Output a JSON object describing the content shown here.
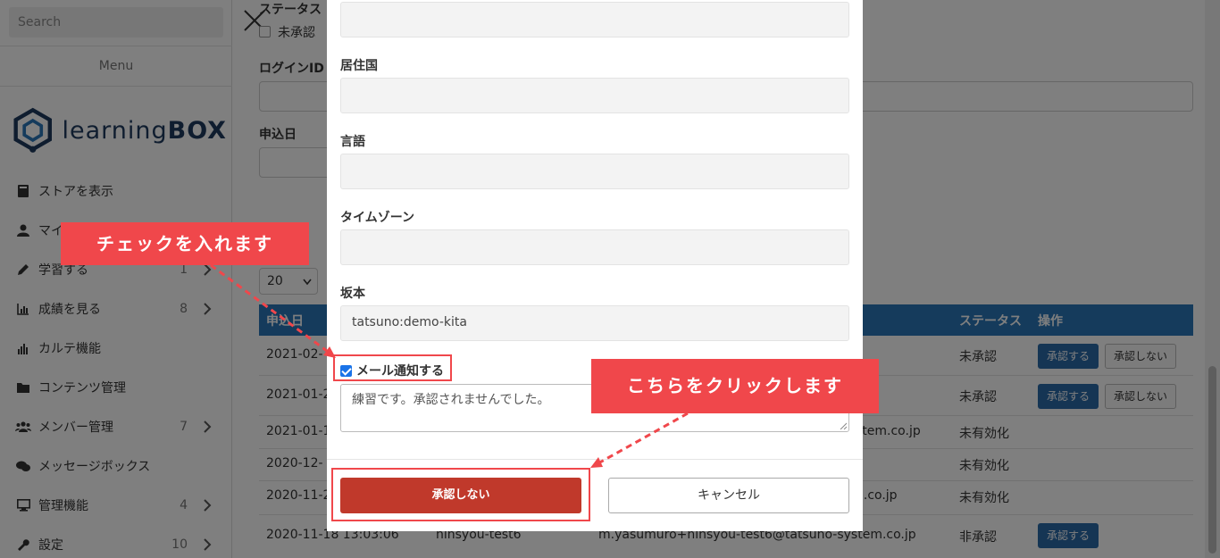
{
  "sidebar": {
    "search_placeholder": "Search",
    "menu_label": "Menu",
    "logo": {
      "light": "learning",
      "bold": "BOX"
    },
    "items": [
      {
        "label": "ストアを表示",
        "count": "",
        "icon": "book-icon"
      },
      {
        "label": "マイページ",
        "count": "",
        "icon": "user-icon"
      },
      {
        "label": "学習する",
        "count": "1",
        "icon": "pencil-icon"
      },
      {
        "label": "成績を見る",
        "count": "8",
        "icon": "chart-icon"
      },
      {
        "label": "カルテ機能",
        "count": "",
        "icon": "bar-chart-icon"
      },
      {
        "label": "コンテンツ管理",
        "count": "",
        "icon": "folder-icon"
      },
      {
        "label": "メンバー管理",
        "count": "7",
        "icon": "users-icon"
      },
      {
        "label": "メッセージボックス",
        "count": "",
        "icon": "comments-icon"
      },
      {
        "label": "管理機能",
        "count": "4",
        "icon": "monitor-icon"
      },
      {
        "label": "設定",
        "count": "10",
        "icon": "wrench-icon"
      }
    ]
  },
  "main": {
    "status_label": "ステータス",
    "unapproved_label": "未承認",
    "login_id_label": "ログインID",
    "apply_date_label": "申込日",
    "per_page": "20",
    "table": {
      "headers": {
        "date": "申込日",
        "status": "ステータス",
        "ops": "操作"
      },
      "rows": [
        {
          "date": "2021-02-",
          "login": "",
          "email": "",
          "status": "未承認",
          "approve": "承認する",
          "reject": "承認しない"
        },
        {
          "date": "2021-01-2",
          "login": "",
          "email": "",
          "status": "未承認",
          "approve": "承認する",
          "reject": "承認しない"
        },
        {
          "date": "2021-01-1",
          "login": "",
          "email": "stem.co.jp",
          "status": "未有効化",
          "approve": "",
          "reject": ""
        },
        {
          "date": "2020-12-",
          "login": "",
          "email": "",
          "status": "未有効化",
          "approve": "",
          "reject": ""
        },
        {
          "date": "2020-11-2",
          "login": "",
          "email": "n.co.jp",
          "status": "未有効化",
          "approve": "",
          "reject": ""
        },
        {
          "date": "2020-11-18 13:03:06",
          "login": "ninsyou-test6",
          "email": "m.yasumuro+ninsyou-test6@tatsuno-system.co.jp",
          "status": "非承認",
          "approve": "承認する",
          "reject": ""
        }
      ]
    }
  },
  "modal": {
    "fields": [
      {
        "label": "",
        "value": ""
      },
      {
        "label": "居住国",
        "value": ""
      },
      {
        "label": "言語",
        "value": ""
      },
      {
        "label": "タイムゾーン",
        "value": ""
      },
      {
        "label": "坂本",
        "value": "tatsuno:demo-kita"
      }
    ],
    "mail_notify_label": "メール通知する",
    "mail_notify_checked": true,
    "message_text": "練習です。承認されませんでした。",
    "reject_button": "承認しない",
    "cancel_button": "キャンセル"
  },
  "annotations": {
    "callout_check": "チェックを入れます",
    "callout_click": "こちらをクリックします",
    "accent_color": "#f0474b"
  },
  "colors": {
    "header_blue": "#2a76b8",
    "approve_blue": "#2a6aa8",
    "reject_red": "#c0392b",
    "logo_navy": "#1e3a5f"
  }
}
